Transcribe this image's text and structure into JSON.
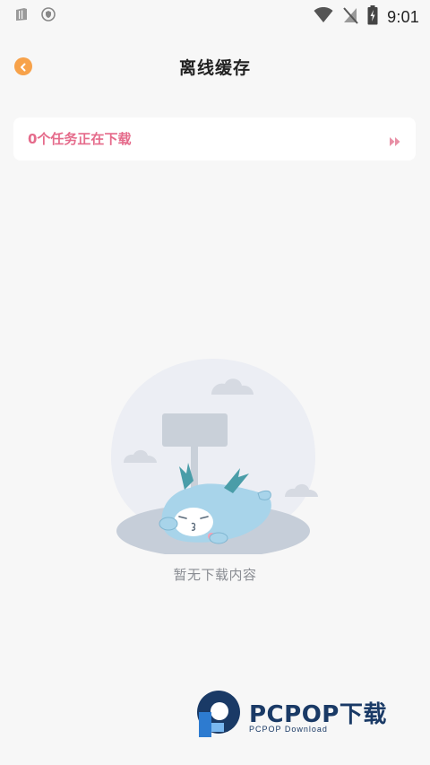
{
  "status_bar": {
    "time": "9:01",
    "left_icons": [
      "sim-card-icon",
      "shield-icon"
    ],
    "right_icons": [
      "wifi-icon",
      "no-signal-icon",
      "battery-charging-icon"
    ]
  },
  "header": {
    "back_icon": "chevron-left-icon",
    "title": "离线缓存"
  },
  "task_card": {
    "text": "0个任务正在下载",
    "arrow_icon": "double-arrow-right-icon",
    "accent_color": "#e56b8b"
  },
  "empty_state": {
    "illustration": "sleeping-dragon-mascot",
    "text": "暂无下载内容"
  },
  "watermark": {
    "title": "PCPOP下载",
    "subtitle": "PCPOP Download"
  },
  "colors": {
    "background": "#f7f7f7",
    "back_button": "#f7a24a",
    "watermark": "#1a3a66"
  }
}
